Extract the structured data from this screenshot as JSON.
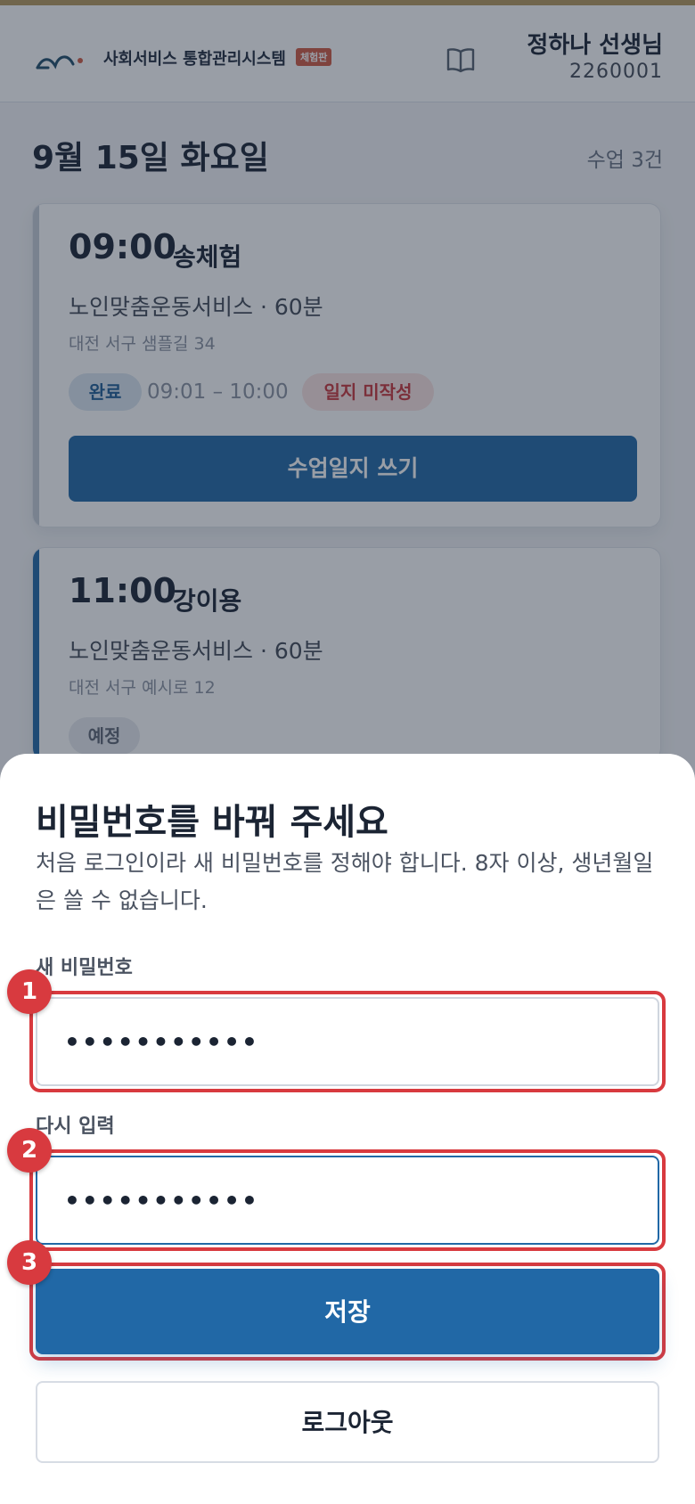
{
  "header": {
    "app_name": "사회서비스 통합관리시스템",
    "trial_badge": "체험판",
    "user_name": "정하나 선생님",
    "user_id": "2260001"
  },
  "schedule": {
    "date_title": "9월 15일 화요일",
    "class_count": "수업 3건",
    "cards": [
      {
        "time": "09:00",
        "client": "송체험",
        "service": "노인맞춤운동서비스 · 60분",
        "address": "대전 서구 샘플길 34",
        "status": "완료",
        "actual_time": "09:01 – 10:00",
        "log_status": "일지 미작성",
        "action_label": "수업일지 쓰기"
      },
      {
        "time": "11:00",
        "client": "강이용",
        "service": "노인맞춤운동서비스 · 60분",
        "address": "대전 서구 예시로 12",
        "status": "예정"
      }
    ]
  },
  "password_sheet": {
    "title": "비밀번호를 바꿔 주세요",
    "description": "처음 로그인이라 새 비밀번호를 정해야 합니다. 8자 이상, 생년월일은 쓸 수 없습니다.",
    "new_password_label": "새 비밀번호",
    "new_password_value": "•••••••••••",
    "confirm_label": "다시 입력",
    "confirm_value": "•••••••••••",
    "save_label": "저장",
    "logout_label": "로그아웃"
  },
  "markers": [
    "1",
    "2",
    "3"
  ],
  "colors": {
    "primary": "#2168a6",
    "highlight": "#d83a3f",
    "accent_bar": "#b79a5d",
    "badge": "#d05a42"
  }
}
